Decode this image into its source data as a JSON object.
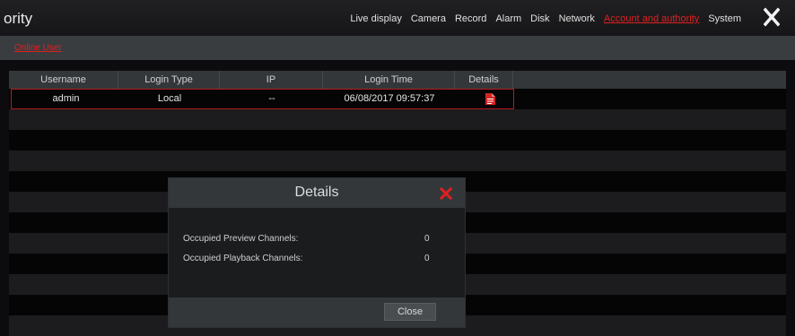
{
  "header": {
    "title": "ority",
    "nav": [
      "Live display",
      "Camera",
      "Record",
      "Alarm",
      "Disk",
      "Network",
      "Account and authority",
      "System"
    ],
    "active_nav": "Account and authority",
    "close_icon": "close-icon"
  },
  "subtab": {
    "label": "Online User"
  },
  "table": {
    "columns": [
      "Username",
      "Login Type",
      "IP",
      "Login Time",
      "Details"
    ],
    "rows": [
      {
        "username": "admin",
        "login_type": "Local",
        "ip": "--",
        "login_time": "06/08/2017 09:57:37",
        "details_icon": "document-icon"
      }
    ]
  },
  "dialog": {
    "title": "Details",
    "fields": [
      {
        "label": "Occupied Preview Channels:",
        "value": "0"
      },
      {
        "label": "Occupied Playback Channels:",
        "value": "0"
      }
    ],
    "close_button": "Close"
  },
  "colors": {
    "accent": "#e02020",
    "background": "#0c0c0e",
    "header": "#34373a"
  }
}
